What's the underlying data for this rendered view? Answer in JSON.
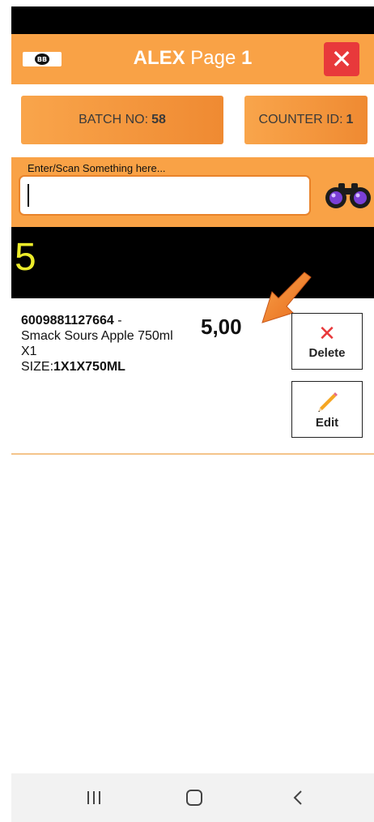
{
  "header": {
    "logo_text": "BB",
    "title_bold": "ALEX",
    "title_word": "Page",
    "page_number": "1"
  },
  "info": {
    "batch_label": "BATCH NO:",
    "batch_value": "58",
    "counter_label": "COUNTER ID:",
    "counter_value": "1"
  },
  "scan": {
    "label": "Enter/Scan Something here...",
    "value": ""
  },
  "count": "5",
  "items": [
    {
      "barcode": "6009881127664",
      "separator": " -",
      "name": "Smack Sours Apple 750ml X1",
      "size_label": "SIZE:",
      "size_value": "1X1X750ML",
      "price": "5,00",
      "delete_label": "Delete",
      "edit_label": "Edit"
    }
  ],
  "colors": {
    "accent": "#f9a246",
    "close": "#e8393b",
    "count": "#ebeb2a"
  },
  "icons": {
    "close": "close-icon",
    "scan": "binoculars-icon",
    "delete": "x-icon",
    "edit": "pencil-icon"
  }
}
